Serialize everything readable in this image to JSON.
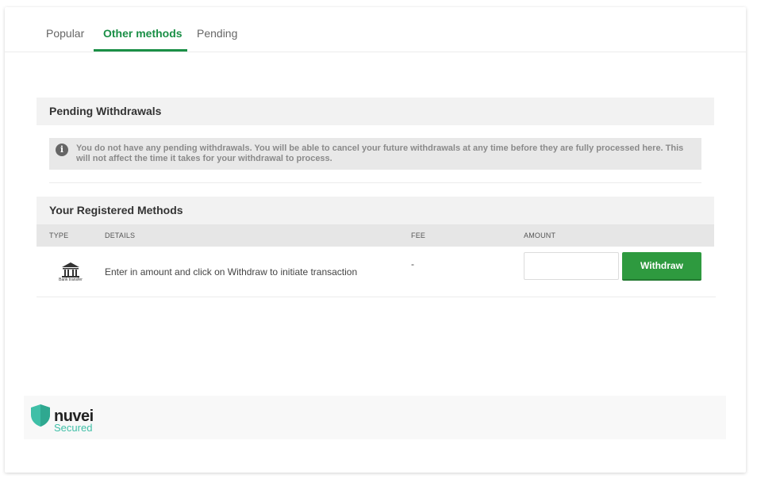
{
  "tabs": [
    {
      "label": "Popular",
      "active": false
    },
    {
      "label": "Other methods",
      "active": true
    },
    {
      "label": "Pending",
      "active": false
    }
  ],
  "pending": {
    "title": "Pending Withdrawals",
    "info_icon": "info-icon",
    "message": "You do not have any pending withdrawals. You will be able to cancel your future withdrawals at any time before they are fully processed here. This will not affect the time it takes for your withdrawal to process."
  },
  "methods": {
    "title": "Your Registered Methods",
    "columns": [
      "TYPE",
      "DETAILS",
      "FEE",
      "AMOUNT"
    ],
    "rows": [
      {
        "type_icon": "bank-icon",
        "type_caption": "Bank transfer",
        "details": "Enter in amount and click on Withdraw to initiate transaction",
        "fee": "-",
        "amount_value": "",
        "amount_placeholder": "",
        "button_label": "Withdraw"
      }
    ]
  },
  "footer": {
    "brand": "nuvei",
    "tagline": "Secured"
  },
  "colors": {
    "accent": "#1a8f46",
    "button": "#2e9a3f",
    "logo_teal": "#3fbfa7"
  }
}
